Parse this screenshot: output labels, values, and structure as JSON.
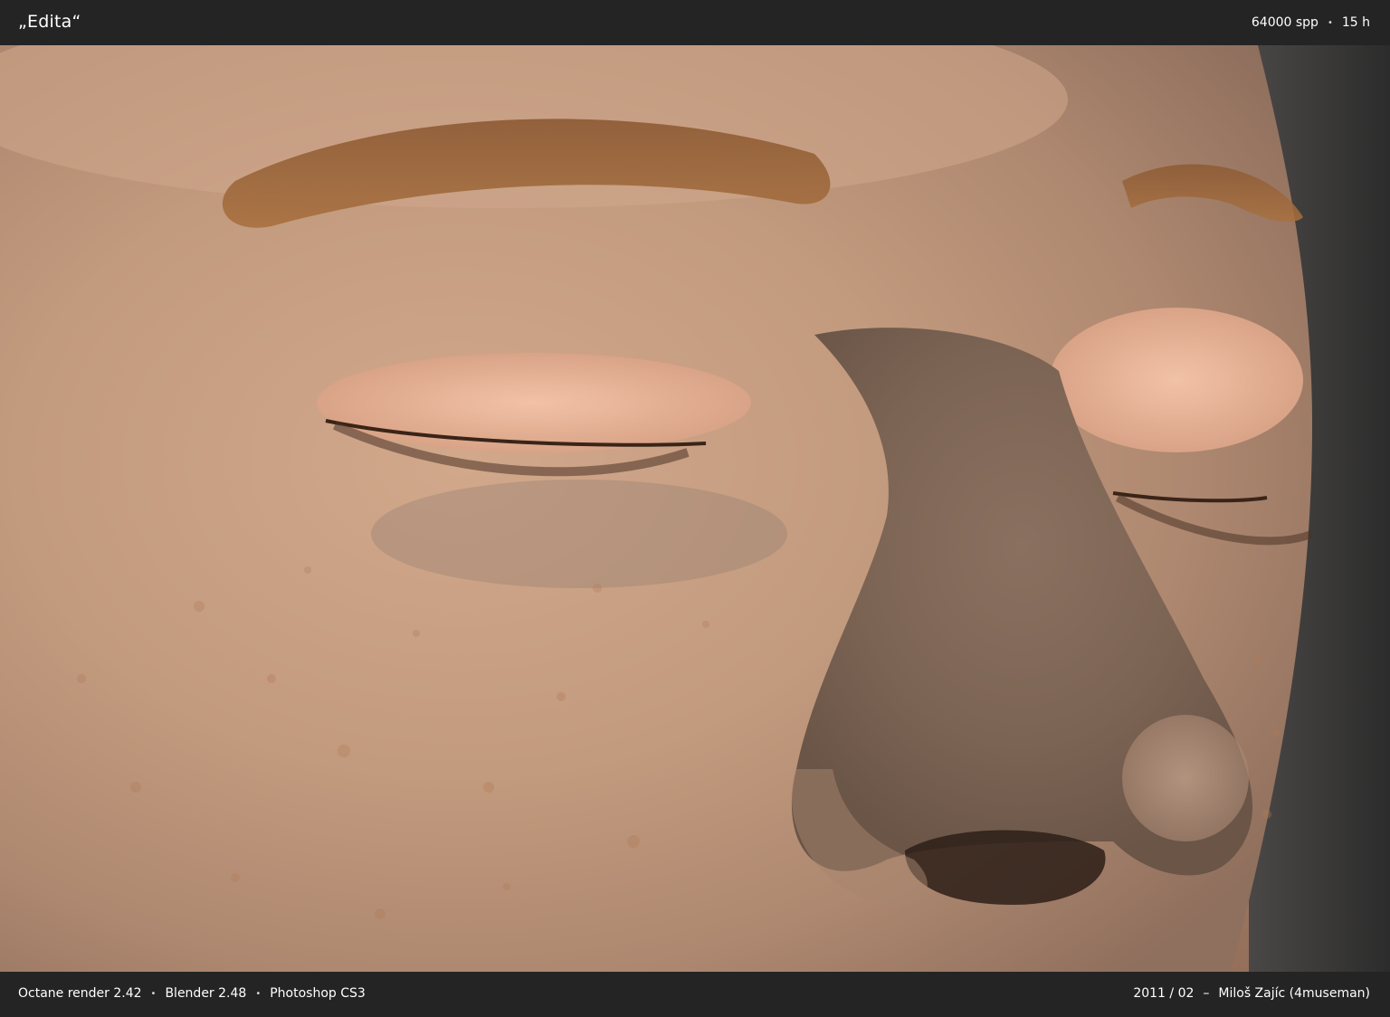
{
  "header": {
    "title": "„Edita“",
    "samples": "64000 spp",
    "separator": "•",
    "render_time": "15 h"
  },
  "image": {
    "subject": "closed-eyes-face-render",
    "background_color": "#232323",
    "skin_color": "#c59a7f"
  },
  "footer": {
    "renderer": "Octane render 2.42",
    "modeler": "Blender 2.48",
    "editor": "Photoshop CS3",
    "separator": "•",
    "date": "2011 / 02",
    "dash": "–",
    "author": "Miloš Zajíc (4museman)"
  }
}
